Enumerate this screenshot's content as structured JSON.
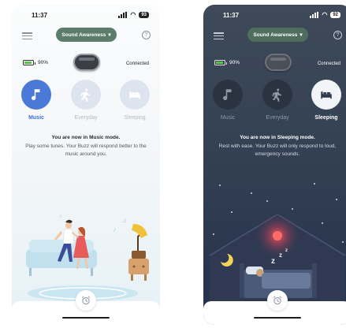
{
  "screens": [
    {
      "status": {
        "time": "11:37",
        "battery_level": "93"
      },
      "header": {
        "dropdown_label": "Sound Awareness",
        "help_icon": "?"
      },
      "device": {
        "battery": "90%",
        "battery_fill": 0.9,
        "connection": "Connected"
      },
      "modes": [
        {
          "label": "Music",
          "icon": "music-note-icon",
          "active": true
        },
        {
          "label": "Everyday",
          "icon": "walking-person-icon",
          "active": false
        },
        {
          "label": "Sleeping",
          "icon": "bed-icon",
          "active": false
        }
      ],
      "description": {
        "title": "You are now in Music mode.",
        "body": "Play some tunes. Your Buzz will respond better to the music around you."
      },
      "theme": {
        "accent": "#4a79d8",
        "dropdown": "#5c7c6c"
      }
    },
    {
      "status": {
        "time": "11:37",
        "battery_level": "92"
      },
      "header": {
        "dropdown_label": "Sound Awareness",
        "help_icon": "?"
      },
      "device": {
        "battery": "90%",
        "battery_fill": 0.9,
        "connection": "Connected"
      },
      "modes": [
        {
          "label": "Music",
          "icon": "music-note-icon",
          "active": false
        },
        {
          "label": "Everyday",
          "icon": "walking-person-icon",
          "active": false
        },
        {
          "label": "Sleeping",
          "icon": "bed-icon",
          "active": true
        }
      ],
      "description": {
        "title": "You are now in Sleeping mode.",
        "body": "Rest with ease. Your Buzz will only respond to loud, emergency sounds."
      },
      "theme": {
        "background": "#344154",
        "dropdown": "#4f6e5e"
      }
    }
  ]
}
